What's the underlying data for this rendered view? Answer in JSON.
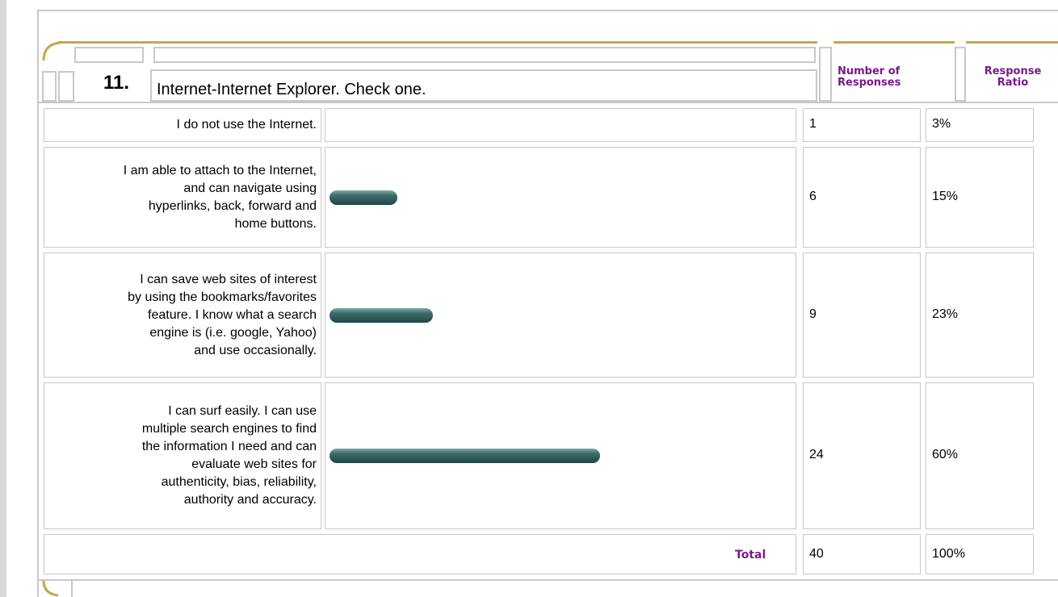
{
  "question": {
    "number": "11.",
    "text": "Internet-Internet Explorer. Check one."
  },
  "headers": {
    "responses": "Number of\nResponses",
    "ratio": "Response\nRatio"
  },
  "rows": [
    {
      "label": "I do not use the Internet.",
      "count": "1",
      "ratio": "3%",
      "fraction": 0.03
    },
    {
      "label": "I am able to attach to the Internet,\nand can navigate using\nhyperlinks, back, forward and\nhome buttons.",
      "count": "6",
      "ratio": "15%",
      "fraction": 0.15
    },
    {
      "label": "I can save web sites of interest\nby using the bookmarks/favorites\nfeature. I know what a search\nengine is (i.e. google, Yahoo)\nand use occasionally.",
      "count": "9",
      "ratio": "23%",
      "fraction": 0.23
    },
    {
      "label": "I can surf easily. I can use\nmultiple search engines to find\nthe information I need and can\nevaluate web sites for\nauthenticity, bias, reliability,\nauthority and accuracy.",
      "count": "24",
      "ratio": "60%",
      "fraction": 0.6
    }
  ],
  "total": {
    "label": "Total",
    "count": "40",
    "ratio": "100%"
  },
  "colors": {
    "frame": "#c8c8c8",
    "accent_gold": "#c9a54e",
    "header_purple": "#7a1a8a",
    "bar": "#2f5a5a"
  }
}
